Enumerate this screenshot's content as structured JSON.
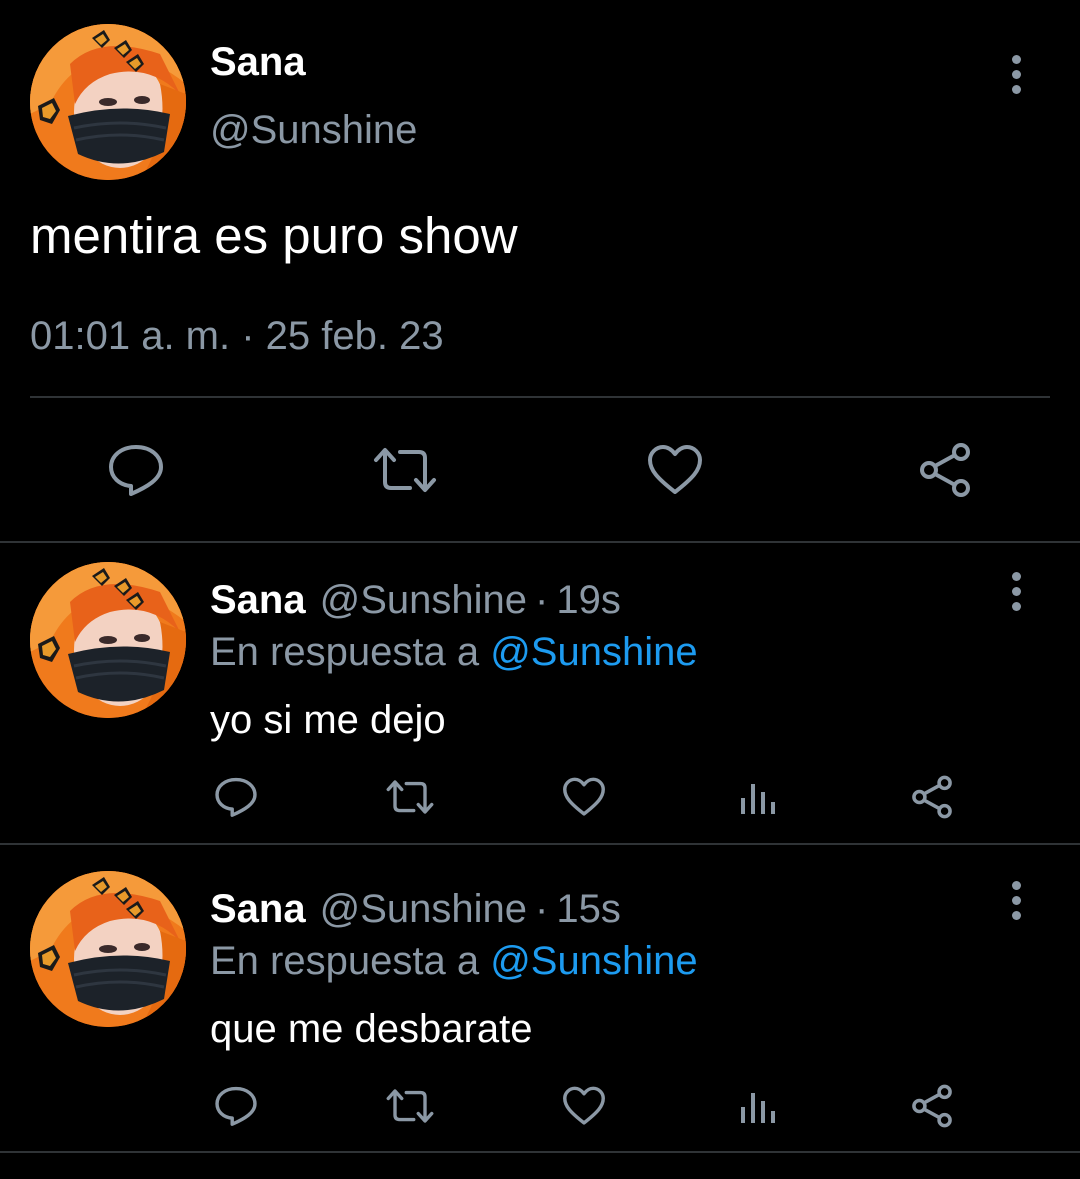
{
  "main_tweet": {
    "author_name": "Sana",
    "author_handle": "@Sunshine",
    "text": "mentira es puro show",
    "timestamp": "01:01 a. m. · 25 feb. 23",
    "actions": [
      "reply-icon",
      "retweet-icon",
      "like-icon",
      "share-icon"
    ]
  },
  "replies": [
    {
      "author_name": "Sana",
      "author_handle": "@Sunshine",
      "separator": "·",
      "time": "19s",
      "reply_prefix": "En respuesta a",
      "reply_to": "@Sunshine",
      "text": "yo si me dejo"
    },
    {
      "author_name": "Sana",
      "author_handle": "@Sunshine",
      "separator": "·",
      "time": "15s",
      "reply_prefix": "En respuesta a",
      "reply_to": "@Sunshine",
      "text": "que me desbarate"
    }
  ],
  "reply_actions": [
    "reply-icon",
    "retweet-icon",
    "like-icon",
    "analytics-icon",
    "share-icon"
  ],
  "colors": {
    "background": "#000000",
    "primary_text": "#ffffff",
    "secondary_text": "#8b98a5",
    "link": "#1d9bf0",
    "divider": "#2f3336"
  }
}
